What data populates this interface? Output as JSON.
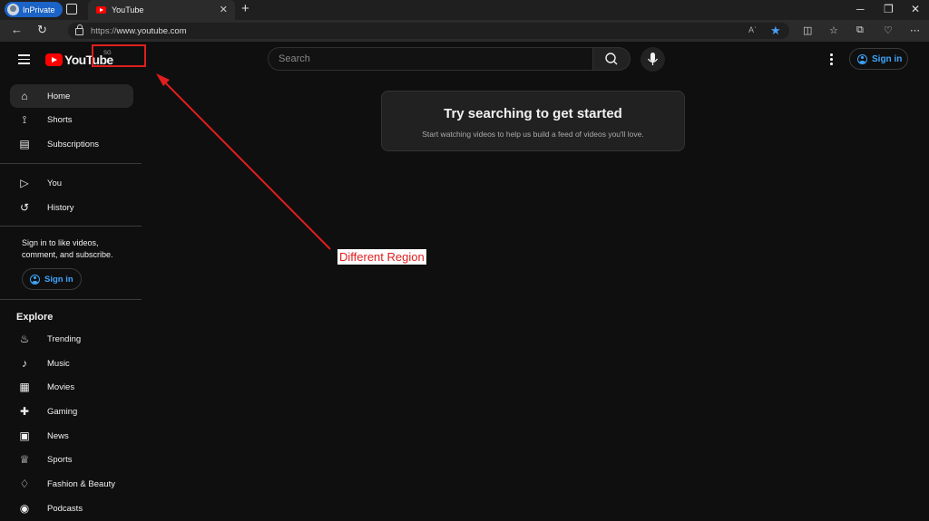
{
  "browser": {
    "inprivate_label": "InPrivate",
    "tab_title": "YouTube",
    "url_protocol": "https://",
    "url_host": "www.youtube.com",
    "reader_label": "Aʾ"
  },
  "youtube": {
    "logo_text": "YouTube",
    "region_code": "SG",
    "search_placeholder": "Search",
    "signin_label": "Sign in",
    "sidebar": {
      "main_items": [
        {
          "label": "Home",
          "icon": "home-icon",
          "active": true
        },
        {
          "label": "Shorts",
          "icon": "shorts-icon"
        },
        {
          "label": "Subscriptions",
          "icon": "subscriptions-icon"
        }
      ],
      "you_items": [
        {
          "label": "You",
          "icon": "you-icon"
        },
        {
          "label": "History",
          "icon": "history-icon"
        }
      ],
      "signin_note": "Sign in to like videos, comment, and subscribe.",
      "signin_label": "Sign in",
      "explore_title": "Explore",
      "explore_items": [
        {
          "label": "Trending",
          "icon": "trending-icon"
        },
        {
          "label": "Music",
          "icon": "music-icon"
        },
        {
          "label": "Movies",
          "icon": "movies-icon"
        },
        {
          "label": "Gaming",
          "icon": "gaming-icon"
        },
        {
          "label": "News",
          "icon": "news-icon"
        },
        {
          "label": "Sports",
          "icon": "sports-icon"
        },
        {
          "label": "Fashion & Beauty",
          "icon": "fashion-icon"
        },
        {
          "label": "Podcasts",
          "icon": "podcasts-icon"
        }
      ]
    },
    "empty_state": {
      "title": "Try searching to get started",
      "subtitle": "Start watching videos to help us build a feed of videos you'll love."
    }
  },
  "annotation": {
    "label": "Different Region",
    "color": "#e01e1e"
  }
}
